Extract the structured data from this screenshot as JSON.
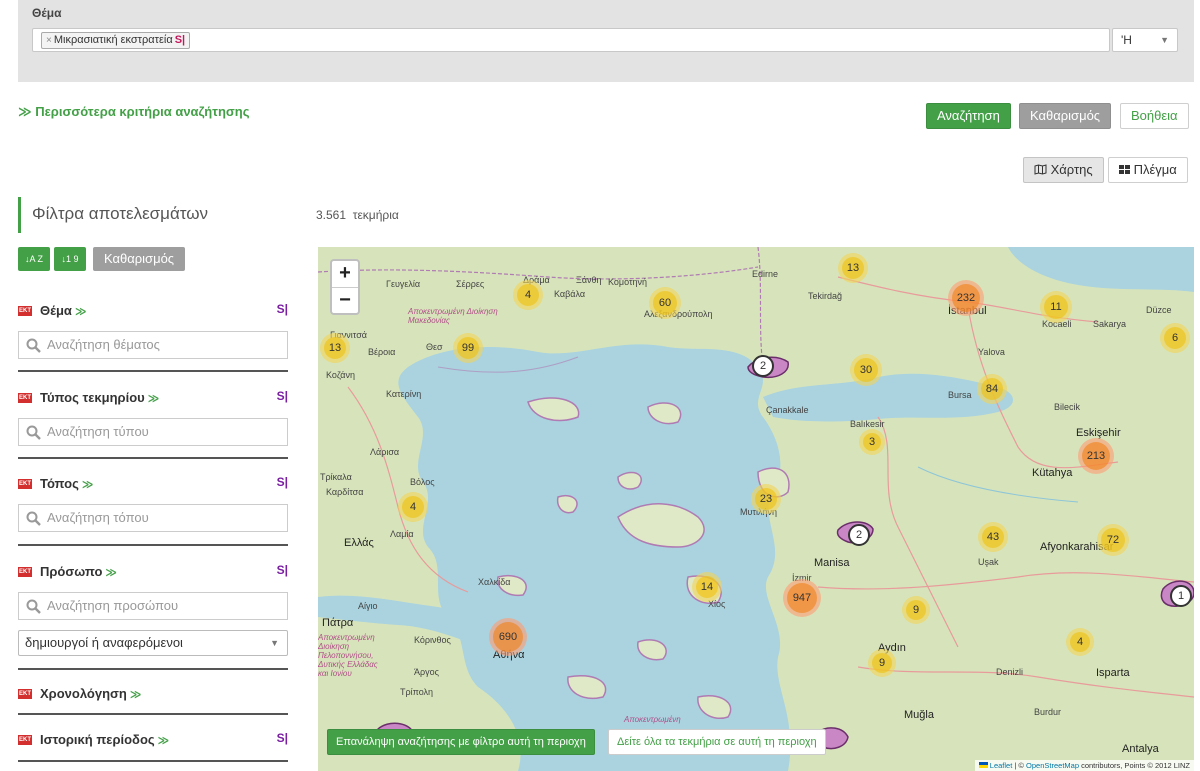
{
  "search": {
    "subject_label": "Θέμα",
    "tag_remove": "×",
    "tag_text": "Μικρασιατική εκστρατεία",
    "tag_badge": "S|",
    "operator": "'Η",
    "more_criteria": "Περισσότερα κριτήρια αναζήτησης",
    "search_button": "Αναζήτηση",
    "clear_button": "Καθαρισμός",
    "help_button": "Βοήθεια"
  },
  "view": {
    "map_button": "Χάρτης",
    "grid_button": "Πλέγμα"
  },
  "sidebar": {
    "title": "Φίλτρα αποτελεσμάτων",
    "sort_az": "↓A Z",
    "sort_19": "↓1 9",
    "clear": "Καθαρισμός",
    "facets": [
      {
        "title": "Θέμα",
        "badge": "S|",
        "placeholder": "Αναζήτηση θέματος"
      },
      {
        "title": "Τύπος τεκμηρίου",
        "badge": "S|",
        "placeholder": "Αναζήτηση τύπου"
      },
      {
        "title": "Τόπος",
        "badge": "S|",
        "placeholder": "Αναζήτηση τόπου"
      },
      {
        "title": "Πρόσωπο",
        "badge": "S|",
        "placeholder": "Αναζήτηση προσώπου",
        "select": "δημιουργοί ή αναφερόμενοι"
      },
      {
        "title": "Χρονολόγηση"
      },
      {
        "title": "Ιστορική περίοδος",
        "badge": "S|"
      }
    ],
    "ekt": "EKT",
    "chevron": "≫"
  },
  "results": {
    "count": "3.561",
    "unit": "τεκμήρια"
  },
  "map": {
    "zoom_in": "+",
    "zoom_out": "−",
    "clusters": [
      "13",
      "4",
      "60",
      "232",
      "11",
      "6",
      "13",
      "99",
      "2",
      "30",
      "84",
      "3",
      "213",
      "4",
      "23",
      "2",
      "43",
      "72",
      "14",
      "947",
      "9",
      "1",
      "690",
      "9",
      "4"
    ],
    "towns": [
      "Γευγελία",
      "Σέρρες",
      "Δράμα",
      "Ξάνθη",
      "Κομοτηνή",
      "Καβάλα",
      "Αλεξανδρούπολη",
      "Edirne",
      "Tekirdağ",
      "İstanbul",
      "Kocaeli",
      "Sakarya",
      "Düzce",
      "Γιαννιτσά",
      "Βέροια",
      "Yalova",
      "Κοζάνη",
      "Κατερίνη",
      "Çanakkale",
      "Bursa",
      "Bilecik",
      "Balıkesir",
      "Eskişehir",
      "Λάρισα",
      "Kütahya",
      "Τρίκαλα",
      "Καρδίτσα",
      "Βόλος",
      "Μυτιλήνη",
      "Λαμία",
      "Ελλάς",
      "Manisa",
      "Uşak",
      "Afyonkarahisar",
      "Χαλκίδα",
      "İzmir",
      "Αίγιο",
      "Πάτρα",
      "Χίος",
      "Κόρινθος",
      "Αθήνα",
      "Aydın",
      "Άργος",
      "Τρίπολη",
      "Denizli",
      "Isparta",
      "Muğla",
      "Burdur",
      "Antalya",
      "Θεσ"
    ],
    "regions": [
      "Αποκεντρωμένη Διοίκηση Μακεδονίας",
      "Αποκεντρωμένη Διοίκηση Πελοποννήσου, Δυτικής Ελλάδας και Ιονίου",
      "Αποκεντρωμένη"
    ],
    "filter_button": "Επανάληψη αναζήτησης με φίλτρο αυτή τη περιοχη",
    "view_all_button": "Δείτε όλα τα τεκμήρια σε αυτή τη περιοχη",
    "attribution_leaflet": "Leaflet",
    "attribution_sep": " | © ",
    "attribution_osm": "OpenStreetMap",
    "attribution_rest": " contributors, Points © 2012 LINZ"
  }
}
